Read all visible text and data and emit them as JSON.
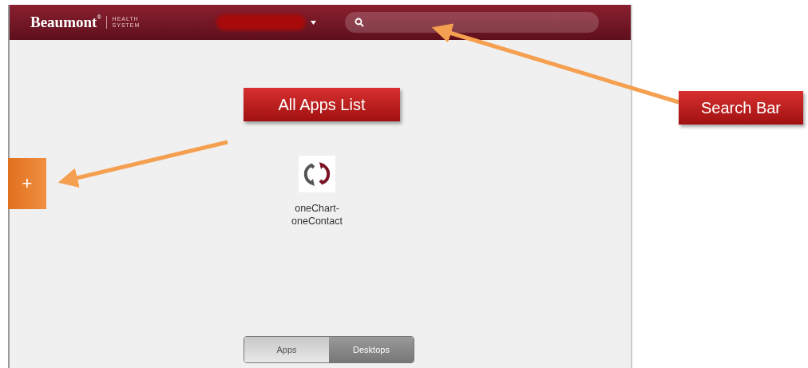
{
  "header": {
    "logo": "Beaumont",
    "logo_mark": "®",
    "logo_subtitle": "HEALTH SYSTEM"
  },
  "add_tab": {
    "label": "+"
  },
  "apps": [
    {
      "name": "oneChart-\noneContact"
    }
  ],
  "view_toggle": [
    {
      "label": "Apps",
      "selected": true
    },
    {
      "label": "Desktops",
      "selected": false
    }
  ],
  "annotations": [
    {
      "text": "All Apps List"
    },
    {
      "text": "Search Bar"
    }
  ]
}
